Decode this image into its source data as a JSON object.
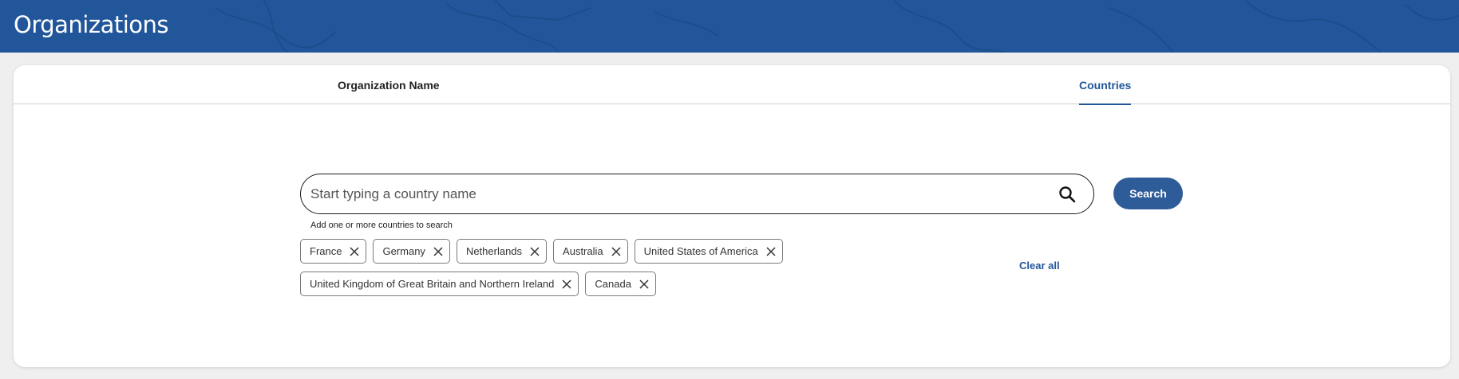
{
  "header": {
    "title": "Organizations",
    "color": "#21569a"
  },
  "tabs": [
    {
      "label": "Organization Name",
      "active": false
    },
    {
      "label": "Countries",
      "active": true
    }
  ],
  "search": {
    "placeholder": "Start typing a country name",
    "value": "",
    "helper": "Add one or more countries to search",
    "button_label": "Search"
  },
  "selected_countries": [
    "France",
    "Germany",
    "Netherlands",
    "Australia",
    "United States of America",
    "United Kingdom of Great Britain and Northern Ireland",
    "Canada"
  ],
  "clear_all_label": "Clear all",
  "icons": {
    "search": "search-icon",
    "remove": "close-icon"
  },
  "accent_color": "#2e5c99"
}
